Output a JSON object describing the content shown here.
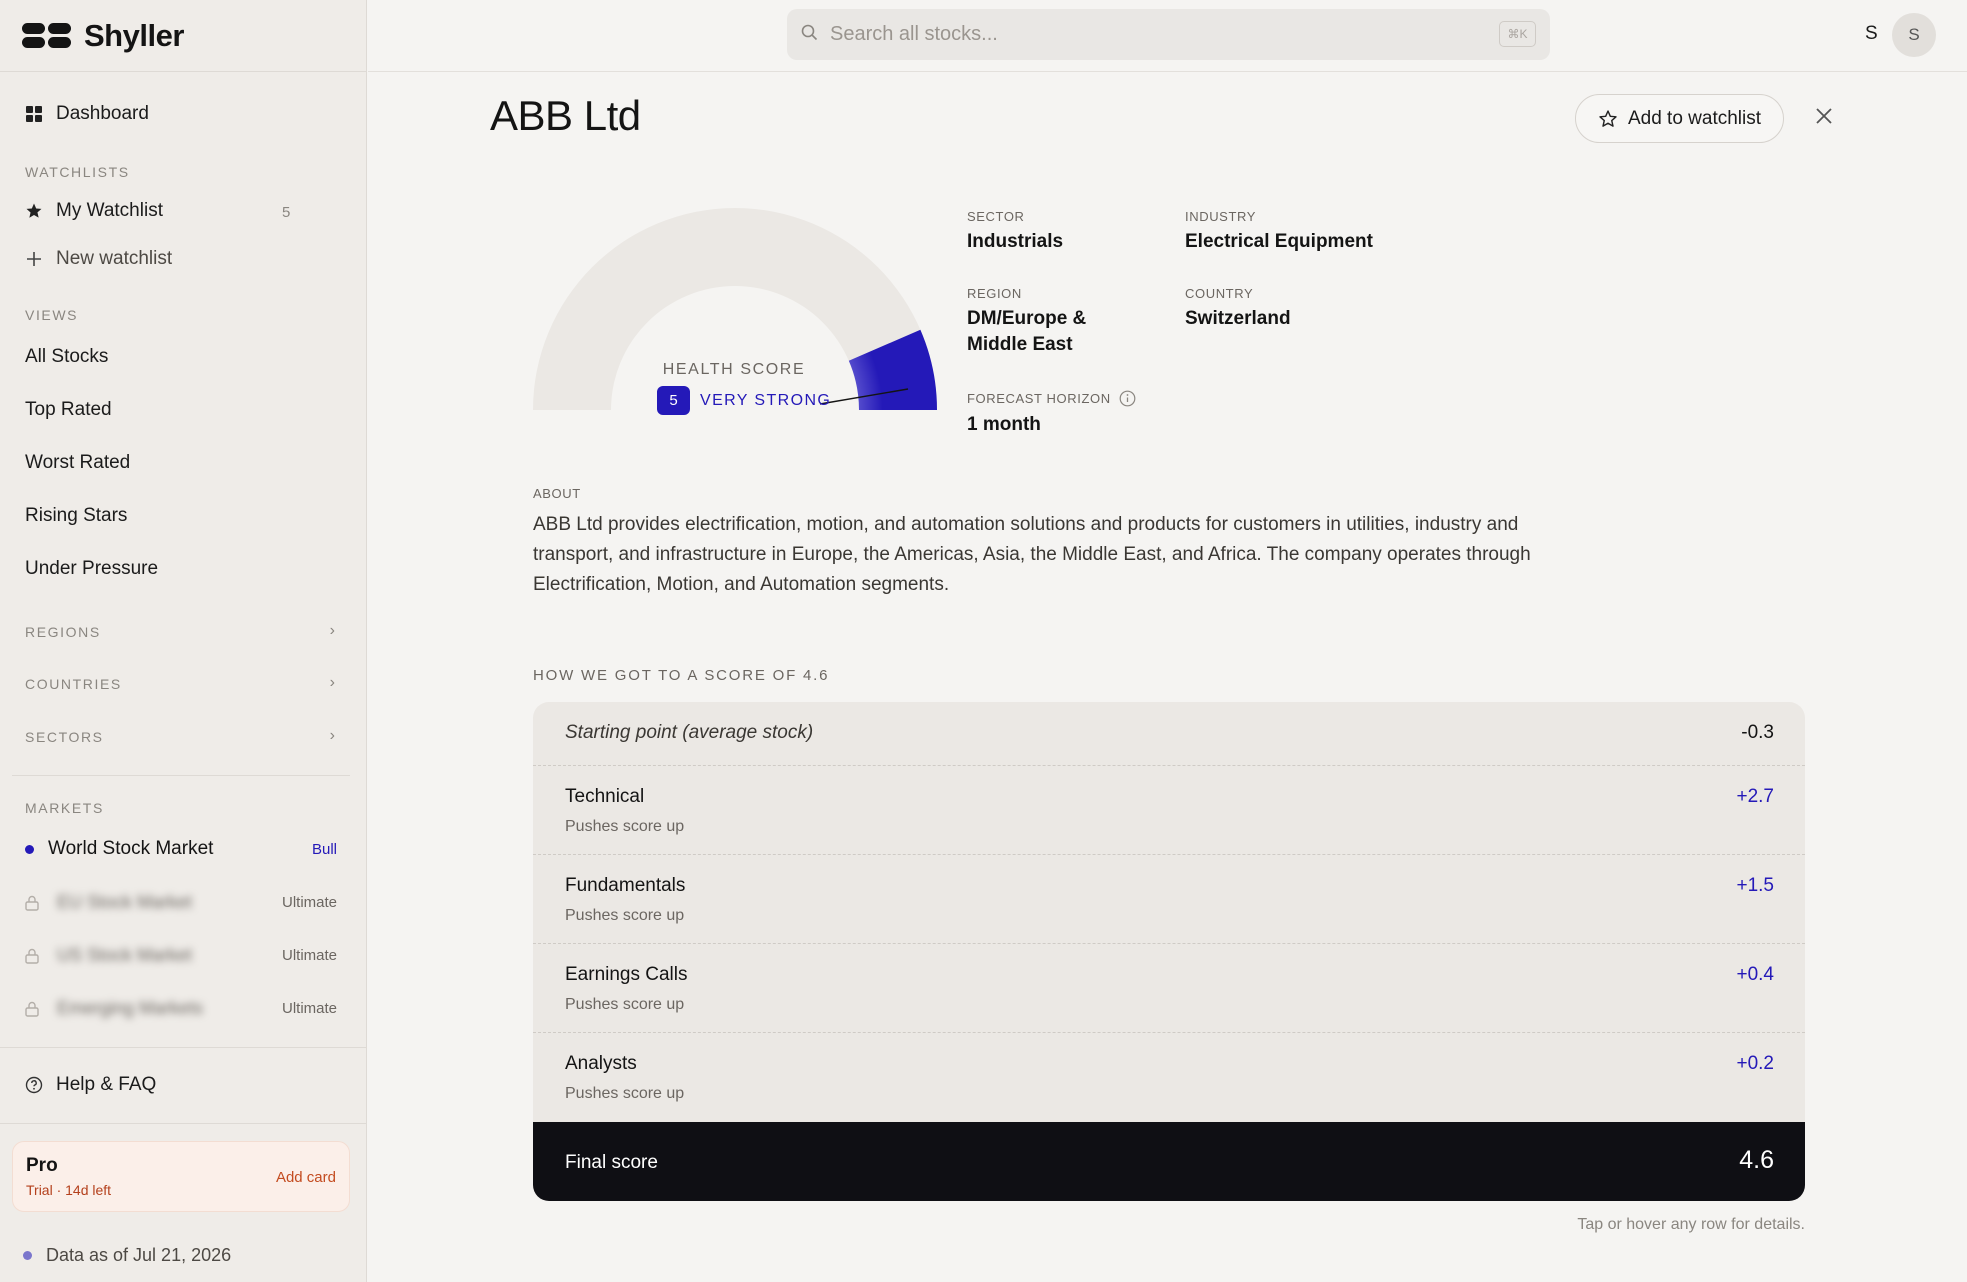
{
  "app": {
    "name": "Shyller"
  },
  "sidebar": {
    "dashboard": "Dashboard",
    "watchlists_header": "WATCHLISTS",
    "my_watchlist": {
      "label": "My Watchlist",
      "count": "5"
    },
    "new_watchlist": "New watchlist",
    "views_header": "VIEWS",
    "views": [
      "All Stocks",
      "Top Rated",
      "Worst Rated",
      "Rising Stars",
      "Under Pressure"
    ],
    "groups": [
      "REGIONS",
      "COUNTRIES",
      "SECTORS"
    ],
    "markets_header": "MARKETS",
    "markets": [
      {
        "name": "World Stock Market",
        "tag": "Bull"
      },
      {
        "name": "EU Stock Market",
        "tag": "Ultimate"
      },
      {
        "name": "US Stock Market",
        "tag": "Ultimate"
      },
      {
        "name": "Emerging Markets",
        "tag": "Ultimate"
      }
    ],
    "help": "Help & FAQ",
    "plan": {
      "title": "Pro",
      "subtitle": "Trial · 14d left",
      "action": "Add card"
    },
    "data_as_of": "Data as of Jul 21, 2026"
  },
  "topbar": {
    "search_placeholder": "Search all stocks...",
    "shortcut": "⌘K",
    "user_initial": "S",
    "avatar_initial": "S"
  },
  "stock": {
    "name": "ABB Ltd",
    "watchlist_button": "Add to watchlist",
    "health": {
      "label": "HEALTH SCORE",
      "level": "5",
      "level_max": 5,
      "rating": "VERY STRONG"
    },
    "meta": {
      "sector_label": "SECTOR",
      "sector": "Industrials",
      "industry_label": "INDUSTRY",
      "industry": "Electrical Equipment",
      "region_label": "REGION",
      "region": "DM/Europe & Middle East",
      "country_label": "COUNTRY",
      "country": "Switzerland",
      "horizon_label": "FORECAST HORIZON",
      "horizon": "1 month"
    },
    "about_label": "ABOUT",
    "about": "ABB Ltd provides electrification, motion, and automation solutions and products for customers in utilities, industry and transport, and infrastructure in Europe, the Americas, Asia, the Middle East, and Africa. The company operates through Electrification, Motion, and Automation segments.",
    "score_header": "HOW WE GOT TO A SCORE OF 4.6",
    "score_rows": [
      {
        "name": "Starting point (average stock)",
        "sub": "",
        "value": "-0.3"
      },
      {
        "name": "Technical",
        "sub": "Pushes score up",
        "value": "+2.7"
      },
      {
        "name": "Fundamentals",
        "sub": "Pushes score up",
        "value": "+1.5"
      },
      {
        "name": "Earnings Calls",
        "sub": "Pushes score up",
        "value": "+0.4"
      },
      {
        "name": "Analysts",
        "sub": "Pushes score up",
        "value": "+0.2"
      }
    ],
    "final_label": "Final score",
    "final_value": "4.6",
    "footnote": "Tap or hover any row for details."
  },
  "colors": {
    "accent": "#2419b8",
    "dark": "#0f0f14",
    "plan_accent": "#c34b1f"
  }
}
